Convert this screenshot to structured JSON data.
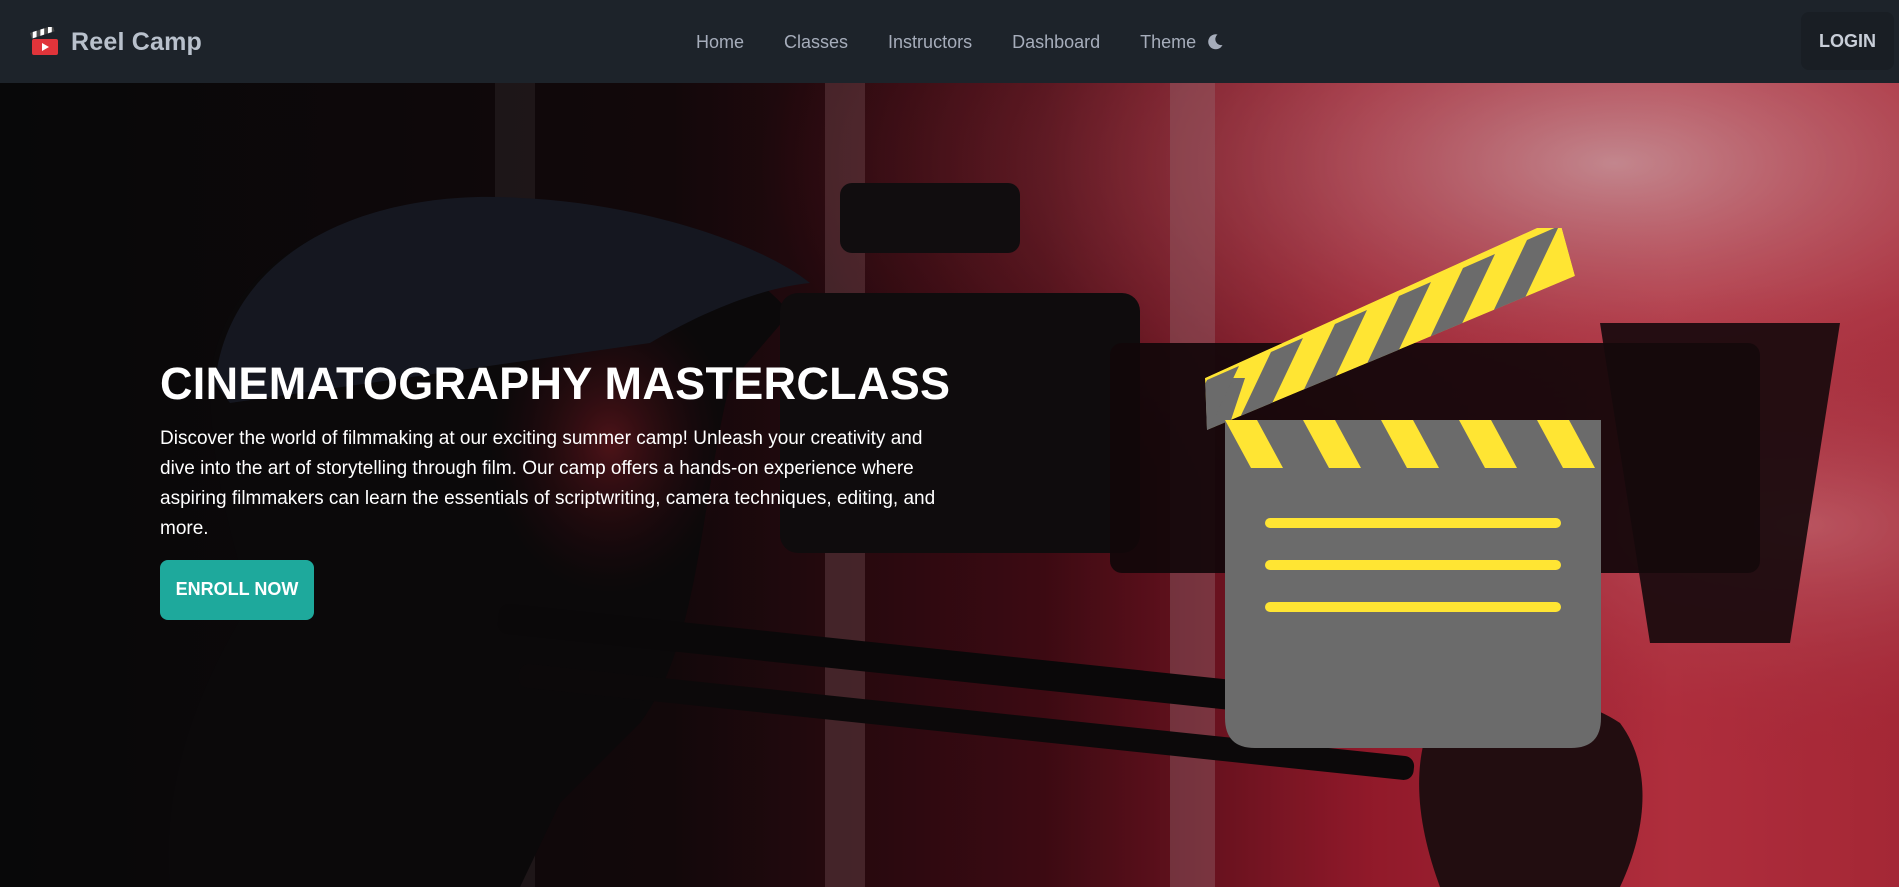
{
  "navbar": {
    "brand_icon": "clapperboard-icon",
    "brand_name": "Reel Camp",
    "links": [
      {
        "label": "Home"
      },
      {
        "label": "Classes"
      },
      {
        "label": "Instructors"
      },
      {
        "label": "Dashboard"
      },
      {
        "label": "Theme",
        "icon": "moon-icon"
      }
    ],
    "login_label": "LOGIN"
  },
  "hero": {
    "title": "CINEMATOGRAPHY MASTERCLASS",
    "description": "Discover the world of filmmaking at our exciting summer camp! Unleash your creativity and dive into the art of storytelling through film. Our camp offers a hands-on experience where aspiring filmmakers can learn the essentials of scriptwriting, camera techniques, editing, and more.",
    "cta_label": "ENROLL NOW",
    "background_image": "camera-operator-photo",
    "illustration": "clapperboard-icon"
  },
  "colors": {
    "navbar_bg": "#1d232a",
    "accent": "#1ea99c",
    "clapper_body": "#6b6b6b",
    "clapper_stripe": "#ffe533"
  }
}
